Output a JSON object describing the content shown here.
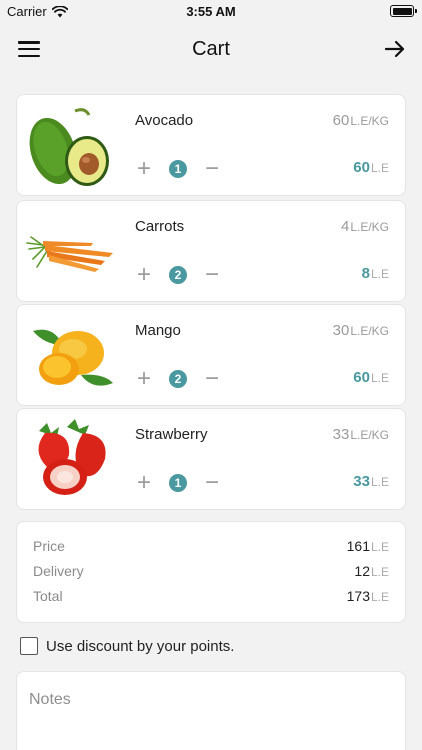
{
  "status_bar": {
    "carrier": "Carrier",
    "time": "3:55 AM"
  },
  "nav": {
    "title": "Cart"
  },
  "currency": "L.E",
  "unit_suffix": "L.E/KG",
  "items": [
    {
      "name": "Avocado",
      "unit_price": "60",
      "quantity": "1",
      "total": "60"
    },
    {
      "name": "Carrots",
      "unit_price": "4",
      "quantity": "2",
      "total": "8"
    },
    {
      "name": "Mango",
      "unit_price": "30",
      "quantity": "2",
      "total": "60"
    },
    {
      "name": "Strawberry",
      "unit_price": "33",
      "quantity": "1",
      "total": "33"
    }
  ],
  "summary": {
    "price_label": "Price",
    "price_value": "161",
    "delivery_label": "Delivery",
    "delivery_value": "12",
    "total_label": "Total",
    "total_value": "173"
  },
  "discount": {
    "label": "Use discount by your points.",
    "checked": false
  },
  "notes": {
    "placeholder": "Notes",
    "value": ""
  },
  "colors": {
    "accent": "#4a98a0",
    "background": "#f2f2f2"
  },
  "icons": {
    "menu": "hamburger-menu-icon",
    "next": "arrow-right-icon",
    "increase": "plus-icon",
    "decrease": "minus-icon",
    "wifi": "wifi-icon",
    "battery": "battery-icon"
  }
}
